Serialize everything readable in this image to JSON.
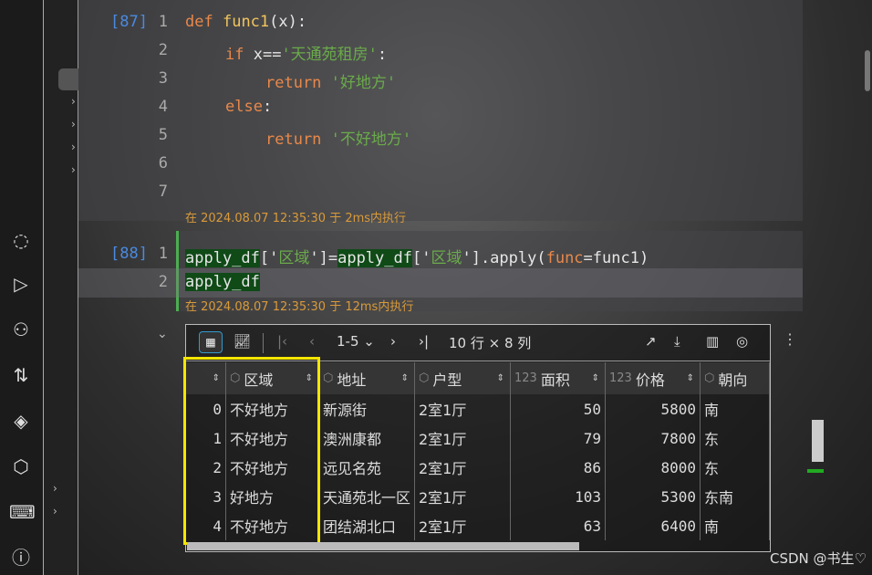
{
  "cells": [
    {
      "count": "[87]",
      "lines": [
        "1",
        "2",
        "3",
        "4",
        "5",
        "6",
        "7"
      ],
      "exec": "在 2024.08.07 12:35:30 于 2ms内执行"
    },
    {
      "count": "[88]",
      "lines": [
        "1",
        "2"
      ],
      "exec": "在 2024.08.07 12:35:30 于 12ms内执行"
    }
  ],
  "code87": {
    "def": "def",
    "fname": "func1",
    "sig": "(x):",
    "if": "if",
    "cond": " x==",
    "s1": "'天通苑租房'",
    "colon": ":",
    "ret": "return",
    "s2": " '好地方'",
    "else": "else",
    "s3": " '不好地方'"
  },
  "code88": {
    "a": "apply_df",
    "b": "['",
    "c": "区域",
    "d": "']=",
    "e": "apply_df",
    "f": "['",
    "g": "区域",
    "h": "'].apply(",
    "i": "func",
    "j": "=func1)",
    "k": "apply_df"
  },
  "table": {
    "pager": "1-5",
    "shape": "10 行 × 8 列",
    "columns": [
      {
        "name": "",
        "type": ""
      },
      {
        "name": "区域",
        "type": "object"
      },
      {
        "name": "地址",
        "type": "object"
      },
      {
        "name": "户型",
        "type": "object"
      },
      {
        "name": "面积",
        "type": "123"
      },
      {
        "name": "价格",
        "type": "123"
      },
      {
        "name": "朝向",
        "type": "object"
      }
    ],
    "rows": [
      [
        "0",
        "不好地方",
        "新源街",
        "2室1厅",
        "50",
        "5800",
        "南"
      ],
      [
        "1",
        "不好地方",
        "澳洲康都",
        "2室1厅",
        "79",
        "7800",
        "东"
      ],
      [
        "2",
        "不好地方",
        "远见名苑",
        "2室1厅",
        "86",
        "8000",
        "东"
      ],
      [
        "3",
        "好地方",
        "天通苑北一区",
        "2室1厅",
        "103",
        "5300",
        "东南"
      ],
      [
        "4",
        "不好地方",
        "团结湖北口",
        "2室1厅",
        "63",
        "6400",
        "南"
      ]
    ]
  },
  "watermark": "CSDN @书生♡",
  "colors": {
    "highlight": "#f5e600",
    "accent": "#4a8ae0"
  }
}
